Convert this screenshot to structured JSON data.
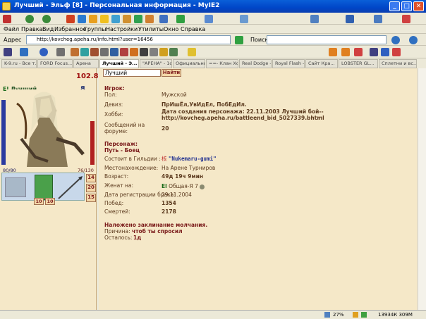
{
  "window": {
    "title": "Лучший - Эльф [8] - Персональная информация - MyIE2",
    "min": "_",
    "max": "□",
    "close": "✕"
  },
  "menu": [
    "Файл",
    "Правка",
    "Вид",
    "Избранное",
    "Группы",
    "Настройки",
    "Утилиты",
    "Окно",
    "Справка"
  ],
  "address": {
    "label": "Адрес",
    "url": "http://kovcheg.apeha.ru/info.html?user=16456",
    "search_label": "Поиск:"
  },
  "tabs": [
    "K-9.ru - Все т...",
    "FORD Focus...",
    "Арена",
    "Лучший - Э...",
    "\"АРЕНА\" - 1o...",
    "Официальны...",
    "==- Клан Хоб...",
    "Real Dodge -...",
    "Royal Flash -...",
    "Сайт Кра...",
    "LOBSTER GL...",
    "Сплетни и вс..."
  ],
  "active_tab_index": 3,
  "character": {
    "search_value": "Лучший",
    "search_button": "Найти",
    "level_value": "102.8",
    "name": "Лучший",
    "level": "8",
    "hp": "80/80",
    "mana": "76/130",
    "side_counts": [
      "14",
      "20",
      "15"
    ],
    "bottom_counts": [
      "10",
      "10"
    ]
  },
  "info": {
    "player_header": "Игрок:",
    "rows": [
      {
        "label": "Пол:",
        "value": "Мужской",
        "bold": false
      },
      {
        "label": "Девиз:",
        "value": "ПрИшЁл,УвИдЕл, ПобЕдИл.",
        "bold": true
      },
      {
        "label": "Хобби:",
        "value": "Дата создания персонажа: 22.11.2003 Лучший бой--",
        "value2": "http://kovcheg.apeha.ru/battleend_bid_5027339.bhtml",
        "bold": true
      },
      {
        "label": "Сообщений на",
        "label2": "форуме:",
        "value": "20",
        "bold": true
      }
    ],
    "character_header": "Персонаж:",
    "character_sub": "Путь - Боец",
    "rows2": [
      {
        "label": "Состоит в Гильдии :",
        "value": "\"Nukemaru-gumi\"",
        "bold": true
      },
      {
        "label": "Местонахождение:",
        "value": "На Арене Турниров",
        "bold": false
      },
      {
        "label": "Возраст:",
        "value": "49д 19ч 9мин",
        "bold": true
      },
      {
        "label": "Женат на:",
        "value": "Общая-Я 7",
        "bold": false
      },
      {
        "label": "Дата регистрации брака:",
        "value": "29.11.2004",
        "bold": false
      },
      {
        "label": "Побед:",
        "value": "1354",
        "bold": true
      },
      {
        "label": "Смертей:",
        "value": "2178",
        "bold": true
      }
    ],
    "guild_glyph": "核",
    "spouse_prefix": "El",
    "silence": {
      "header": "Наложено заклинание молчания.",
      "reason_label": "Причина:",
      "reason_value": "чтоб ты спросил",
      "remain_label": "Осталось:",
      "remain_value": "1д"
    }
  },
  "status": {
    "zoom": "27%",
    "time": "13934К 309М"
  }
}
